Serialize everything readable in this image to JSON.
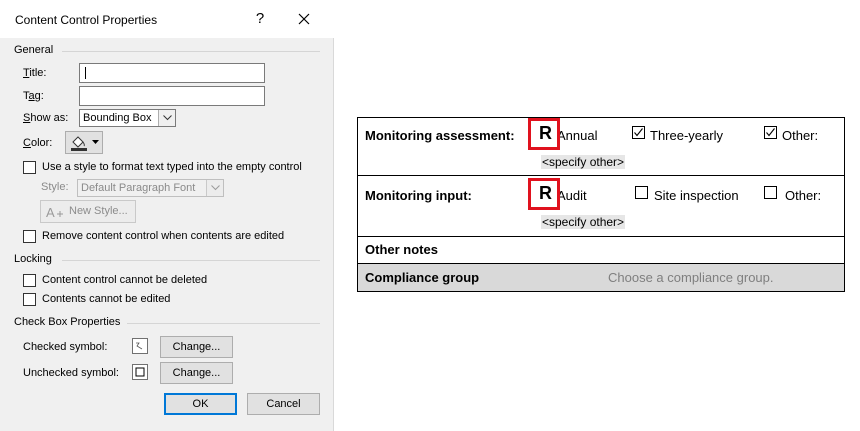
{
  "dialog": {
    "title": "Content Control Properties",
    "help": "?",
    "general": {
      "heading": "General",
      "title_label": "Title:",
      "title_value": "",
      "tag_label": "Tag:",
      "tag_value": "",
      "show_as_label": "Show as:",
      "show_as_value": "Bounding Box",
      "color_label": "Color:",
      "use_style_label": "Use a style to format text typed into the empty control",
      "style_label": "Style:",
      "style_value": "Default Paragraph Font",
      "new_style_label": "New Style...",
      "remove_label": "Remove content control when contents are edited"
    },
    "locking": {
      "heading": "Locking",
      "cannot_delete": "Content control cannot be deleted",
      "cannot_edit": "Contents cannot be edited"
    },
    "checkbox_props": {
      "heading": "Check Box Properties",
      "checked_label": "Checked symbol:",
      "unchecked_label": "Unchecked symbol:",
      "change_label": "Change..."
    },
    "ok": "OK",
    "cancel": "Cancel"
  },
  "document": {
    "row1": {
      "label": "Monitoring assessment:",
      "r_symbol": "R",
      "opt1": "Annual",
      "opt2": "Three-yearly",
      "opt3": "Other:",
      "placeholder": "<specify other>"
    },
    "row2": {
      "label": "Monitoring input:",
      "r_symbol": "R",
      "opt1": "Audit",
      "opt2": "Site inspection",
      "opt3": "Other:",
      "placeholder": "<specify other>"
    },
    "row3": {
      "label": "Other notes"
    },
    "row4": {
      "label": "Compliance group",
      "placeholder": "Choose a compliance group."
    }
  }
}
